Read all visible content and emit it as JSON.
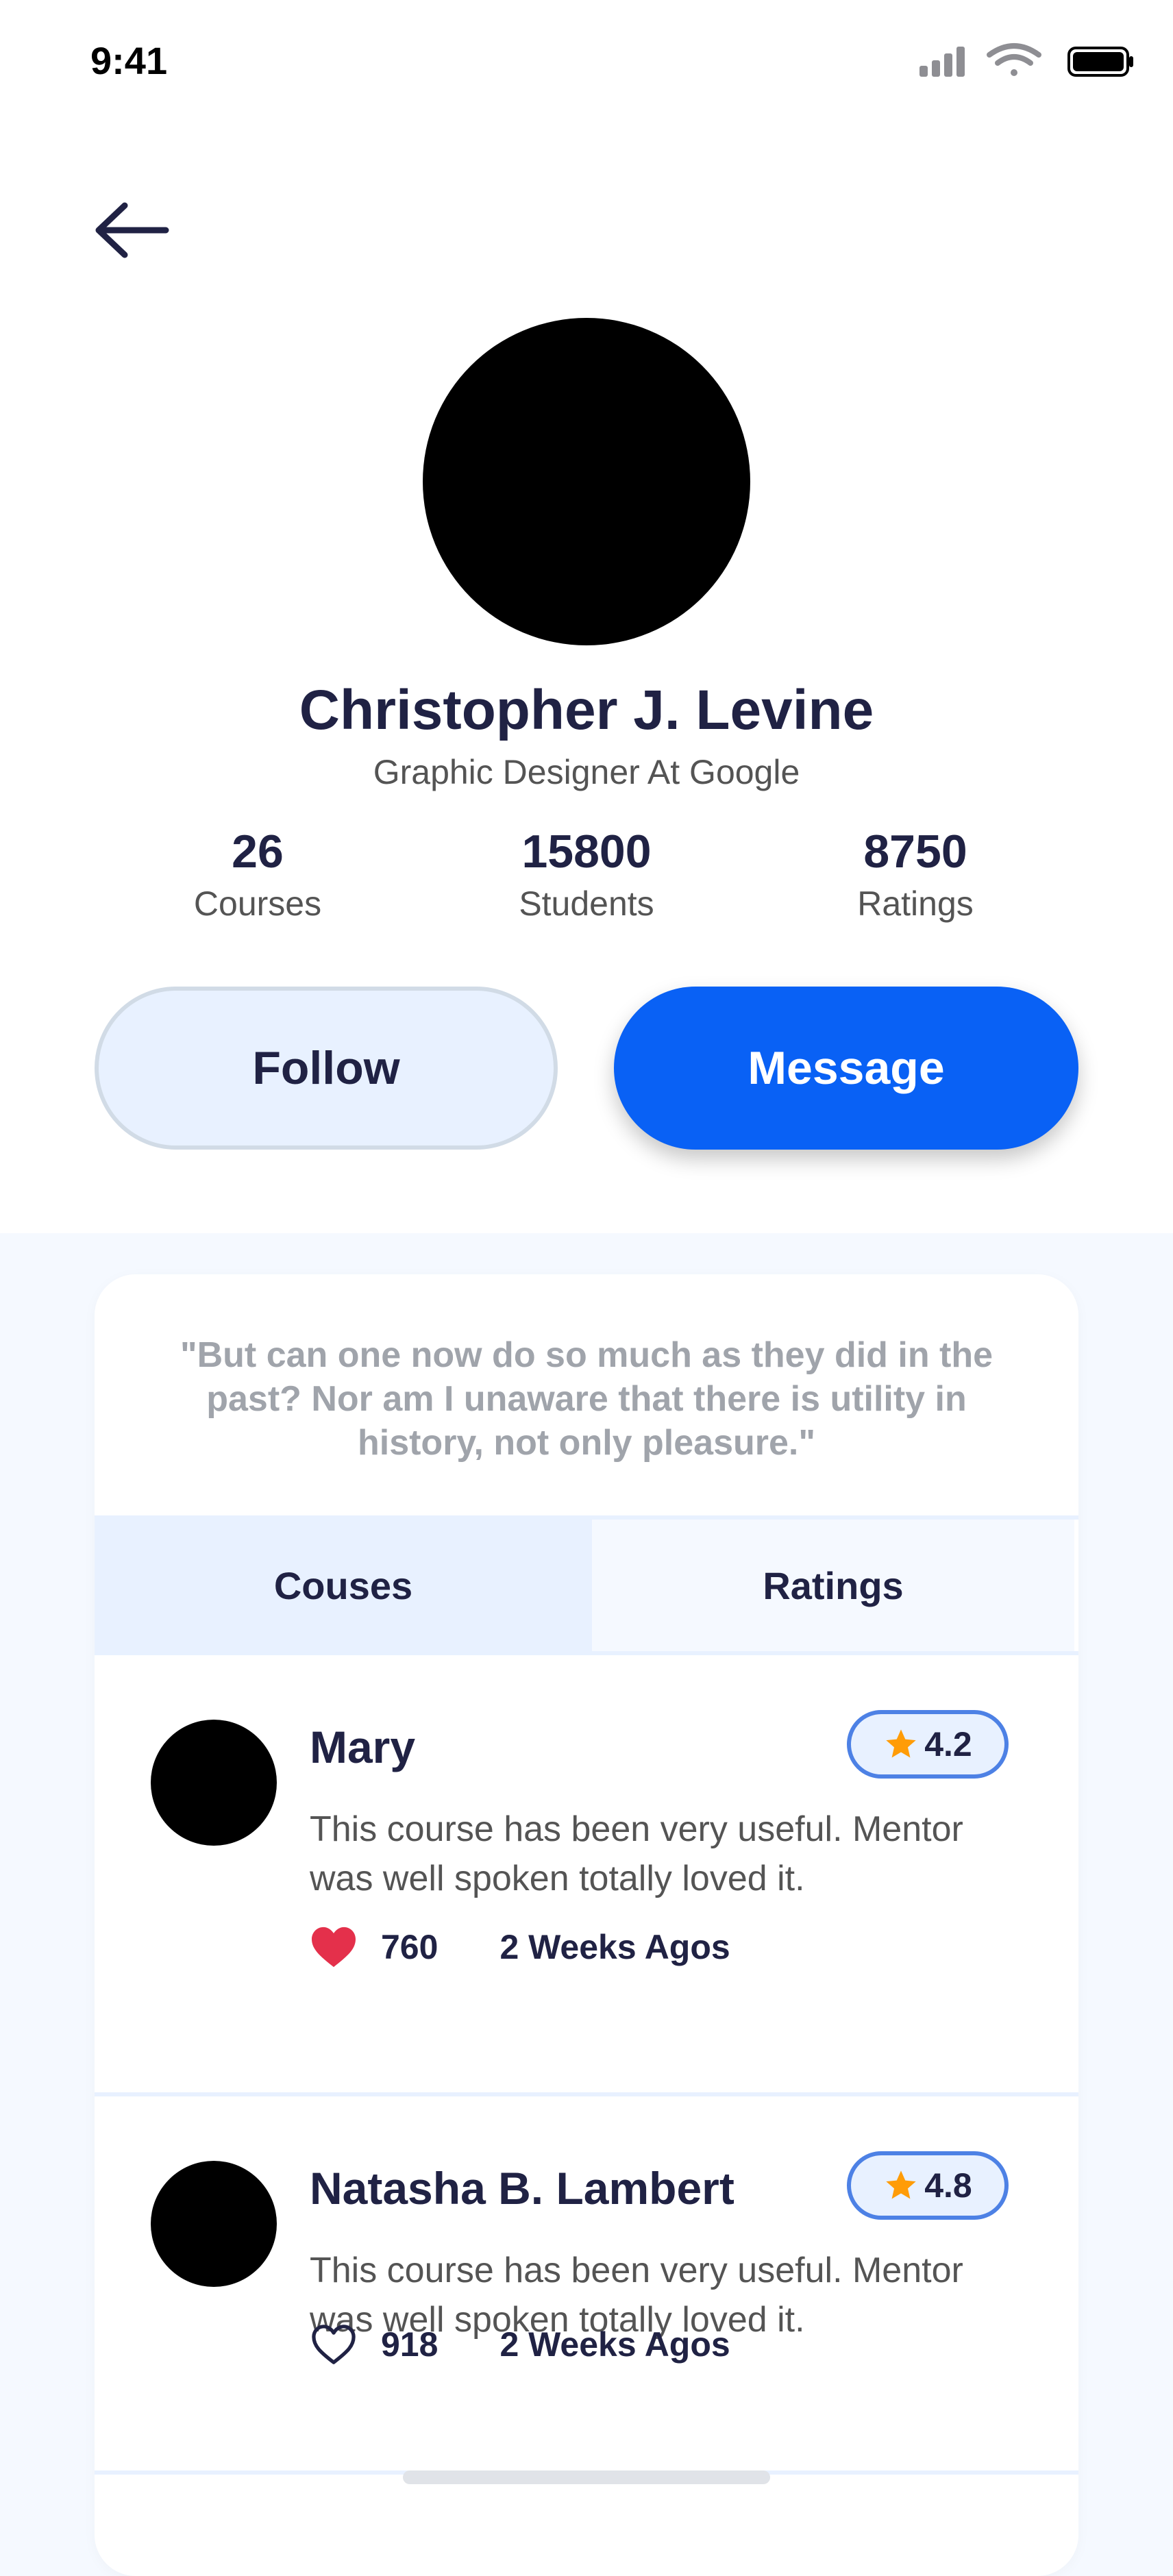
{
  "status_bar": {
    "time": "9:41"
  },
  "profile": {
    "name": "Christopher J. Levine",
    "title": "Graphic Designer At Google",
    "stats": [
      {
        "value": "26",
        "label": "Courses"
      },
      {
        "value": "15800",
        "label": "Students"
      },
      {
        "value": "8750",
        "label": "Ratings"
      }
    ]
  },
  "actions": {
    "follow_label": "Follow",
    "message_label": "Message"
  },
  "quote": "\"But can one now do so much as they did in the past? Nor am I unaware that there is utility in history, not only pleasure.\"",
  "tabs": [
    {
      "label": "Couses",
      "active": true
    },
    {
      "label": "Ratings",
      "active": false
    }
  ],
  "reviews": [
    {
      "name": "Mary",
      "rating": "4.2",
      "text": "This course has been very useful. Mentor was well spoken totally loved it.",
      "likes": "760",
      "liked": true,
      "time": "2 Weeks Agos"
    },
    {
      "name": "Natasha B. Lambert",
      "rating": "4.8",
      "text": "This course has been very useful. Mentor was well spoken totally loved it.",
      "likes": "918",
      "liked": false,
      "time": "2 Weeks Agos"
    }
  ],
  "colors": {
    "accent": "#0961f5",
    "text_dark": "#202244",
    "text_gray": "#545454",
    "star": "#ff9c07",
    "heart": "#e4304b",
    "background": "#f5f9ff"
  },
  "icons": [
    "back-arrow-icon",
    "signal-icon",
    "wifi-icon",
    "battery-icon",
    "star-icon",
    "heart-icon"
  ]
}
